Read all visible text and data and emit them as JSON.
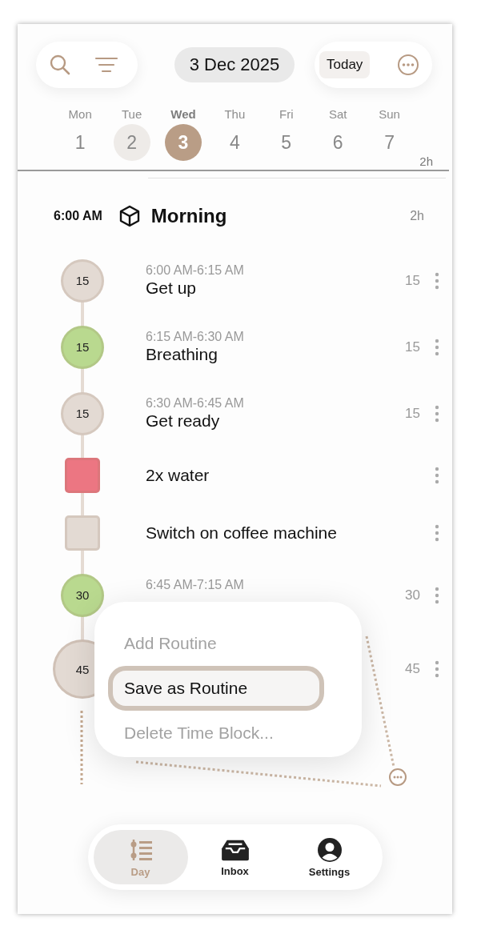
{
  "header": {
    "date": "3 Dec 2025",
    "today": "Today"
  },
  "week": {
    "days": [
      {
        "name": "Mon",
        "num": "1",
        "selected": false,
        "marked": false
      },
      {
        "name": "Tue",
        "num": "2",
        "selected": false,
        "marked": true
      },
      {
        "name": "Wed",
        "num": "3",
        "selected": true,
        "marked": false
      },
      {
        "name": "Thu",
        "num": "4",
        "selected": false,
        "marked": false
      },
      {
        "name": "Fri",
        "num": "5",
        "selected": false,
        "marked": false
      },
      {
        "name": "Sat",
        "num": "6",
        "selected": false,
        "marked": false
      },
      {
        "name": "Sun",
        "num": "7",
        "selected": false,
        "marked": false
      }
    ],
    "total": "2h"
  },
  "section": {
    "time": "6:00 AM",
    "title": "Morning",
    "duration": "2h"
  },
  "items": [
    {
      "kind": "circle",
      "count": "15",
      "color": "#e3dad3",
      "time": "6:00 AM-6:15 AM",
      "title": "Get up",
      "duration": "15"
    },
    {
      "kind": "circle",
      "count": "15",
      "color": "#b9d98f",
      "time": "6:15 AM-6:30 AM",
      "title": "Breathing",
      "duration": "15"
    },
    {
      "kind": "circle",
      "count": "15",
      "color": "#e3dad3",
      "time": "6:30 AM-6:45 AM",
      "title": "Get ready",
      "duration": "15"
    },
    {
      "kind": "square",
      "color": "#ec7682",
      "title": "2x water"
    },
    {
      "kind": "square",
      "color": "#e3dad3",
      "title": "Switch on coffee machine"
    },
    {
      "kind": "circle",
      "count": "30",
      "color": "#b9d98f",
      "time": "6:45 AM-7:15 AM",
      "duration": "30"
    },
    {
      "kind": "big",
      "count": "45",
      "color": "#e3dad3",
      "duration": "45"
    }
  ],
  "menu": [
    {
      "label": "Add Routine",
      "disabled": true,
      "selected": false
    },
    {
      "label": "Save as Routine",
      "disabled": false,
      "selected": true
    },
    {
      "label": "Delete Time Block...",
      "disabled": true,
      "selected": false
    }
  ],
  "nav": [
    {
      "label": "Day",
      "kind": "day",
      "selected": true
    },
    {
      "label": "Inbox",
      "kind": "inbox",
      "selected": false
    },
    {
      "label": "Settings",
      "kind": "settings",
      "selected": false
    }
  ]
}
